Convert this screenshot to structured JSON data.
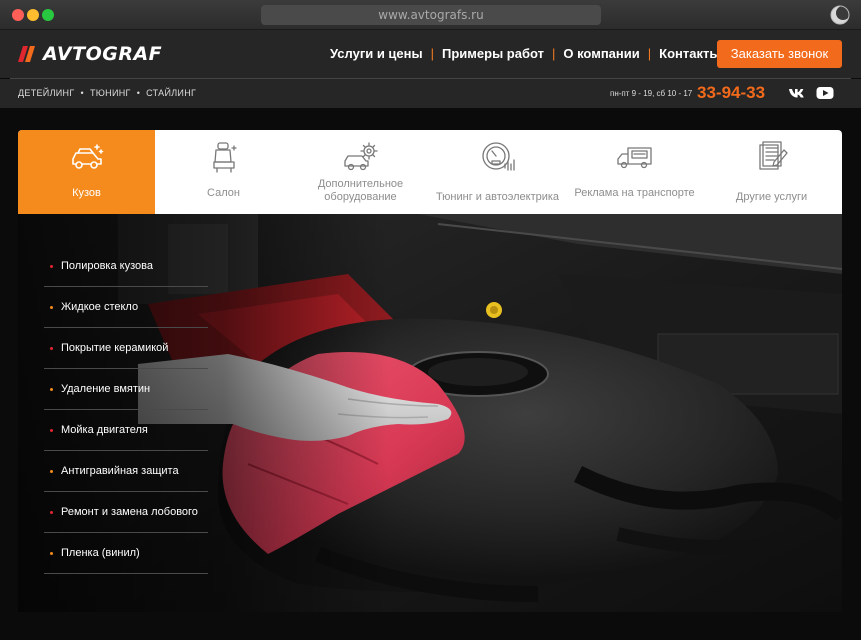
{
  "browser": {
    "url": "www.avtografs.ru"
  },
  "header": {
    "logo_text": "AVTOGRAF",
    "nav": [
      {
        "label": "Услуги и цены"
      },
      {
        "label": "Примеры работ"
      },
      {
        "label": "О компании"
      },
      {
        "label": "Контакты"
      }
    ],
    "cta_label": "Заказать звонок",
    "tags": [
      "ДЕТЕЙЛИНГ",
      "ТЮНИНГ",
      "СТАЙЛИНГ"
    ],
    "hours": "пн-пт 9 - 19, сб 10 - 17",
    "phone": "33-94-33",
    "social": [
      {
        "icon": "vk-icon"
      },
      {
        "icon": "youtube-icon"
      }
    ]
  },
  "tabs": [
    {
      "label": "Кузов",
      "icon": "car-sparkle-icon",
      "active": true
    },
    {
      "label": "Салон",
      "icon": "car-seat-icon",
      "active": false
    },
    {
      "label": "Дополнительное оборудование",
      "icon": "car-gear-icon",
      "active": false
    },
    {
      "label": "Тюнинг и автоэлектрика",
      "icon": "gauge-icon",
      "active": false
    },
    {
      "label": "Реклама на транспорте",
      "icon": "truck-ad-icon",
      "active": false
    },
    {
      "label": "Другие услуги",
      "icon": "document-pen-icon",
      "active": false
    }
  ],
  "services": [
    {
      "label": "Полировка кузова",
      "dot_color": "#e0262f"
    },
    {
      "label": "Жидкое стекло",
      "dot_color": "#f48b1c"
    },
    {
      "label": "Покрытие керамикой",
      "dot_color": "#e0262f"
    },
    {
      "label": "Удаление вмятин",
      "dot_color": "#f48b1c"
    },
    {
      "label": "Мойка двигателя",
      "dot_color": "#e0262f"
    },
    {
      "label": "Антигравийная защита",
      "dot_color": "#f48b1c"
    },
    {
      "label": "Ремонт и замена лобового",
      "dot_color": "#e0262f"
    },
    {
      "label": "Пленка (винил)",
      "dot_color": "#f48b1c"
    }
  ],
  "colors": {
    "accent": "#f26a1b",
    "tab_active": "#f48b1c",
    "header_bg": "#262626"
  }
}
